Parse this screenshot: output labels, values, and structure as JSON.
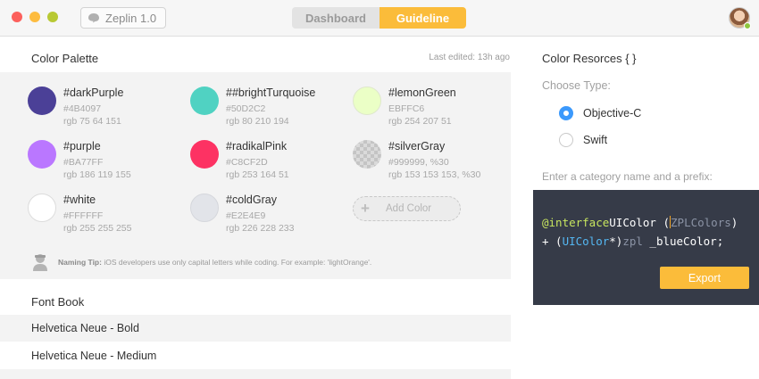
{
  "window": {
    "app_label": "Zeplin 1.0"
  },
  "header": {
    "tabs": [
      {
        "label": "Dashboard",
        "active": false
      },
      {
        "label": "Guideline",
        "active": true
      }
    ],
    "accent": "#fbbc3a"
  },
  "color_palette": {
    "title": "Color Palette",
    "last_edited": "Last edited: 13h ago",
    "colors": [
      {
        "name": "#darkPurple",
        "hex": "#4B4097",
        "rgb": "rgb 75 64 151",
        "swatch": "#4b4097"
      },
      {
        "name": "##brightTurquoise",
        "hex": "#50D2C2",
        "rgb": "rgb 80 210 194",
        "swatch": "#50d2c2"
      },
      {
        "name": "#lemonGreen",
        "hex": "EBFFC6",
        "rgb": "rgb 254 207 51",
        "swatch": "#ebffc6"
      },
      {
        "name": "#purple",
        "hex": "#BA77FF",
        "rgb": "rgb 186 119 155",
        "swatch": "#ba77ff"
      },
      {
        "name": "#radikalPink",
        "hex": "#C8CF2D",
        "rgb": "rgb 253 164 51",
        "swatch": "#fd3263"
      },
      {
        "name": "#silverGray",
        "hex": "#999999, %30",
        "rgb": "rgb 153 153 153, %30",
        "swatch": "#cfcfcf"
      },
      {
        "name": "#white",
        "hex": "#FFFFFF",
        "rgb": "rgb 255 255 255",
        "swatch": "#ffffff"
      },
      {
        "name": "#coldGray",
        "hex": "#E2E4E9",
        "rgb": "rgb 226 228 233",
        "swatch": "#e2e4e9"
      }
    ],
    "add_color_label": "Add Color",
    "tip_label": "Naming Tip:",
    "tip_text": "iOS developers use only capital letters while coding. For example: 'lightOrange'."
  },
  "font_book": {
    "title": "Font Book",
    "fonts": [
      "Helvetica Neue - Bold",
      "Helvetica Neue - Medium"
    ]
  },
  "color_resources": {
    "title": "Color Resorces { }",
    "choose_type": "Choose Type:",
    "options": [
      {
        "label": "Objective-C",
        "selected": true
      },
      {
        "label": "Swift",
        "selected": false
      }
    ],
    "prefix_prompt": "Enter a category name and a prefix:",
    "code": {
      "kw_interface": "@interface",
      "class_name": "UIColor",
      "open_paren": " (",
      "category_placeholder": "ZPLColors",
      "close_paren": ")",
      "line2_prefix": "+ (",
      "return_type": "UIColor",
      "line2_mid": "*)",
      "method_prefix": "zpl",
      "method_name": " _blueColor;"
    },
    "export_label": "Export"
  }
}
